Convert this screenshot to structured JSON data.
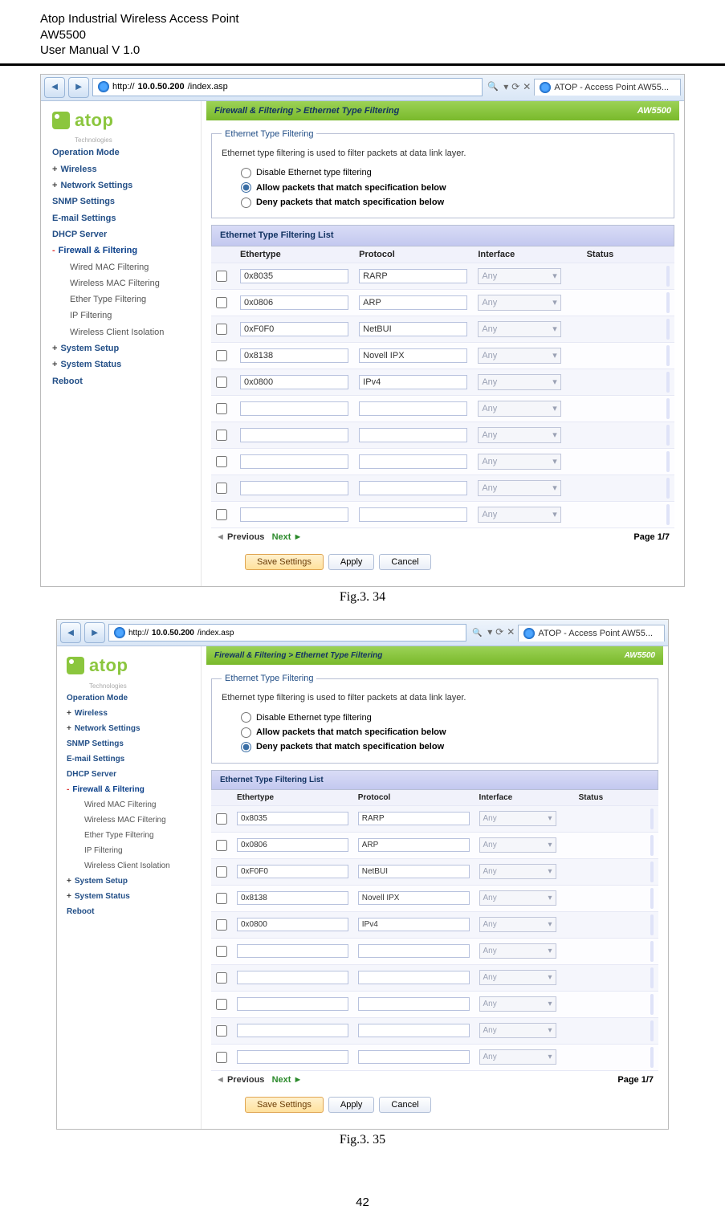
{
  "doc_header": {
    "line1": "Atop Industrial Wireless Access Point",
    "line2": "AW5500",
    "line3": "User Manual V 1.0"
  },
  "page_number": "42",
  "figures": [
    {
      "caption": "Fig.3. 34",
      "radio_selected_index": 1
    },
    {
      "caption": "Fig.3. 35",
      "radio_selected_index": 2
    }
  ],
  "browser": {
    "url_prefix": "http://",
    "url_host": "10.0.50.200",
    "url_path": "/index.asp",
    "tab_title": "ATOP - Access Point AW55...",
    "search_icon": "🔍",
    "dropdown_glyph": "▾",
    "refresh_glyph": "⟳",
    "close_glyph": "✕"
  },
  "logo": {
    "text": "atop",
    "sub": "Technologies"
  },
  "sidebar": [
    {
      "label": "Operation Mode",
      "type": "item"
    },
    {
      "label": "Wireless",
      "type": "expand",
      "sign": "+"
    },
    {
      "label": "Network Settings",
      "type": "expand",
      "sign": "+"
    },
    {
      "label": "SNMP Settings",
      "type": "item"
    },
    {
      "label": "E-mail Settings",
      "type": "item"
    },
    {
      "label": "DHCP Server",
      "type": "item"
    },
    {
      "label": "Firewall & Filtering",
      "type": "expand",
      "sign": "-",
      "active": true
    },
    {
      "label": "Wired MAC Filtering",
      "type": "sub"
    },
    {
      "label": "Wireless MAC Filtering",
      "type": "sub"
    },
    {
      "label": "Ether Type Filtering",
      "type": "sub"
    },
    {
      "label": "IP Filtering",
      "type": "sub"
    },
    {
      "label": "Wireless Client Isolation",
      "type": "sub"
    },
    {
      "label": "System Setup",
      "type": "expand",
      "sign": "+"
    },
    {
      "label": "System Status",
      "type": "expand",
      "sign": "+"
    },
    {
      "label": "Reboot",
      "type": "item"
    }
  ],
  "page": {
    "breadcrumb": "Firewall & Filtering > Ethernet Type Filtering",
    "model": "AW5500",
    "group_title": "Ethernet Type Filtering",
    "group_desc": "Ethernet type filtering is used to filter packets at data link layer.",
    "radios": [
      "Disable Ethernet type filtering",
      "Allow packets that match specification below",
      "Deny packets that match specification below"
    ],
    "list_title": "Ethernet Type Filtering List",
    "columns": [
      "Ethertype",
      "Protocol",
      "Interface",
      "Status"
    ],
    "iface_placeholder": "Any",
    "rows": [
      {
        "ether": "0x8035",
        "proto": "RARP"
      },
      {
        "ether": "0x0806",
        "proto": "ARP"
      },
      {
        "ether": "0xF0F0",
        "proto": "NetBUI"
      },
      {
        "ether": "0x8138",
        "proto": "Novell IPX"
      },
      {
        "ether": "0x0800",
        "proto": "IPv4"
      },
      {
        "ether": "",
        "proto": ""
      },
      {
        "ether": "",
        "proto": ""
      },
      {
        "ether": "",
        "proto": ""
      },
      {
        "ether": "",
        "proto": ""
      },
      {
        "ether": "",
        "proto": ""
      }
    ],
    "pager": {
      "prev": "Previous",
      "next": "Next",
      "page": "Page 1/7"
    },
    "buttons": {
      "save": "Save Settings",
      "apply": "Apply",
      "cancel": "Cancel"
    }
  }
}
